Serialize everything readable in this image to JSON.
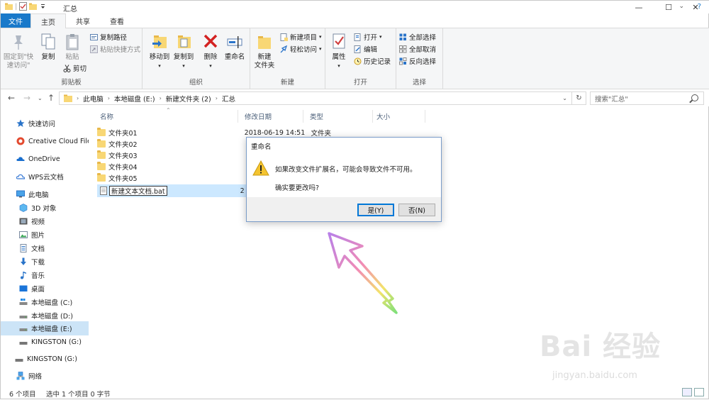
{
  "window": {
    "title": "汇总"
  },
  "tabs": [
    {
      "label": "文件"
    },
    {
      "label": "主页"
    },
    {
      "label": "共享"
    },
    {
      "label": "查看"
    }
  ],
  "ribbon": {
    "clipboard": {
      "label": "剪贴板",
      "pin": "固定到\"快\n速访问\"",
      "copy": "复制",
      "paste": "粘贴",
      "copy_path": "复制路径",
      "paste_shortcut": "粘贴快捷方式",
      "cut": "剪切"
    },
    "organize": {
      "label": "组织",
      "move_to": "移动到",
      "copy_to": "复制到",
      "delete": "删除",
      "rename": "重命名"
    },
    "new": {
      "label": "新建",
      "new_folder": "新建\n文件夹",
      "new_item": "新建项目",
      "easy_access": "轻松访问"
    },
    "open": {
      "label": "打开",
      "properties": "属性",
      "open": "打开",
      "edit": "编辑",
      "history": "历史记录"
    },
    "select": {
      "label": "选择",
      "select_all": "全部选择",
      "select_none": "全部取消",
      "invert": "反向选择"
    }
  },
  "address": {
    "crumbs": [
      "此电脑",
      "本地磁盘 (E:)",
      "新建文件夹 (2)",
      "汇总"
    ],
    "search_placeholder": "搜索\"汇总\""
  },
  "sidebar": {
    "items": [
      {
        "label": "快速访问"
      },
      {
        "label": "Creative Cloud Files"
      },
      {
        "label": "OneDrive"
      },
      {
        "label": "WPS云文档"
      },
      {
        "label": "此电脑"
      },
      {
        "label": "3D 对象"
      },
      {
        "label": "视频"
      },
      {
        "label": "图片"
      },
      {
        "label": "文档"
      },
      {
        "label": "下载"
      },
      {
        "label": "音乐"
      },
      {
        "label": "桌面"
      },
      {
        "label": "本地磁盘 (C:)"
      },
      {
        "label": "本地磁盘 (D:)"
      },
      {
        "label": "本地磁盘 (E:)"
      },
      {
        "label": "KINGSTON (G:)"
      },
      {
        "label": "KINGSTON (G:)"
      },
      {
        "label": "网络"
      }
    ]
  },
  "columns": {
    "name": "名称",
    "modified": "修改日期",
    "type": "类型",
    "size": "大小"
  },
  "files": [
    {
      "name": "文件夹01",
      "modified": "2018-06-19 14:51",
      "type": "文件夹"
    },
    {
      "name": "文件夹02",
      "modified": "",
      "type": ""
    },
    {
      "name": "文件夹03",
      "modified": "",
      "type": ""
    },
    {
      "name": "文件夹04",
      "modified": "",
      "type": ""
    },
    {
      "name": "文件夹05",
      "modified": "",
      "type": ""
    },
    {
      "name": "新建文本文档.bat",
      "modified": "2",
      "type": ""
    }
  ],
  "status": {
    "count": "6 个项目",
    "selected": "选中 1 个项目  0 字节"
  },
  "dialog": {
    "title": "重命名",
    "message": "如果改变文件扩展名，可能会导致文件不可用。",
    "question": "确实要更改吗?",
    "yes": "是(Y)",
    "no": "否(N)"
  },
  "watermark": {
    "text": "Bai 经验",
    "url": "jingyan.baidu.com"
  },
  "colors": {
    "accent": "#1979ca",
    "selection": "#cce8ff",
    "folder": "#f8d775"
  }
}
